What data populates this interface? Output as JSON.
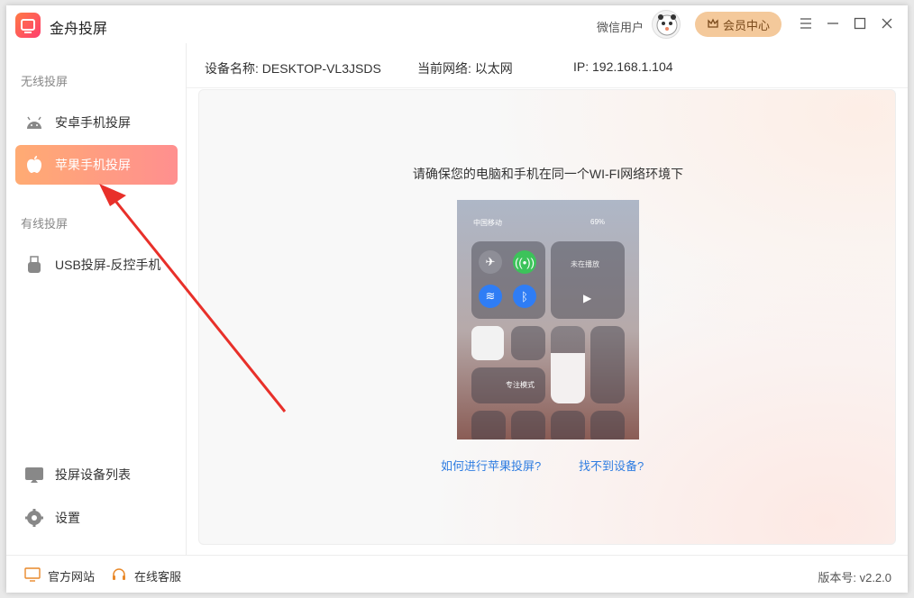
{
  "app": {
    "title": "金舟投屏"
  },
  "header": {
    "user_name": "微信用户",
    "vip_label": "会员中心"
  },
  "sidebar": {
    "wireless_title": "无线投屏",
    "wired_title": "有线投屏",
    "items": [
      {
        "label": "安卓手机投屏",
        "icon": "android-icon",
        "active": false
      },
      {
        "label": "苹果手机投屏",
        "icon": "apple-icon",
        "active": true
      },
      {
        "label": "USB投屏-反控手机",
        "icon": "usb-icon",
        "active": false
      },
      {
        "label": "投屏设备列表",
        "icon": "device-list-icon",
        "active": false
      },
      {
        "label": "设置",
        "icon": "gear-icon",
        "active": false
      }
    ]
  },
  "infobar": {
    "device_name": "设备名称: DESKTOP-VL3JSDS",
    "network": "当前网络:  以太网",
    "ip": "IP: 192.168.1.104"
  },
  "main": {
    "hint": "请确保您的电脑和手机在同一个WI-FI网络环境下",
    "phone": {
      "carrier": "中国移动",
      "battery": "69%",
      "now_playing": "未在播放",
      "focus_mode": "专注模式"
    },
    "links": [
      "如何进行苹果投屏?",
      "找不到设备?"
    ]
  },
  "footer": {
    "website": "官方网站",
    "support": "在线客服",
    "version": "版本号: v2.2.0"
  },
  "colors": {
    "accent": "#ff8f6e",
    "link": "#2f7de1",
    "arrow": "#e8302a"
  }
}
